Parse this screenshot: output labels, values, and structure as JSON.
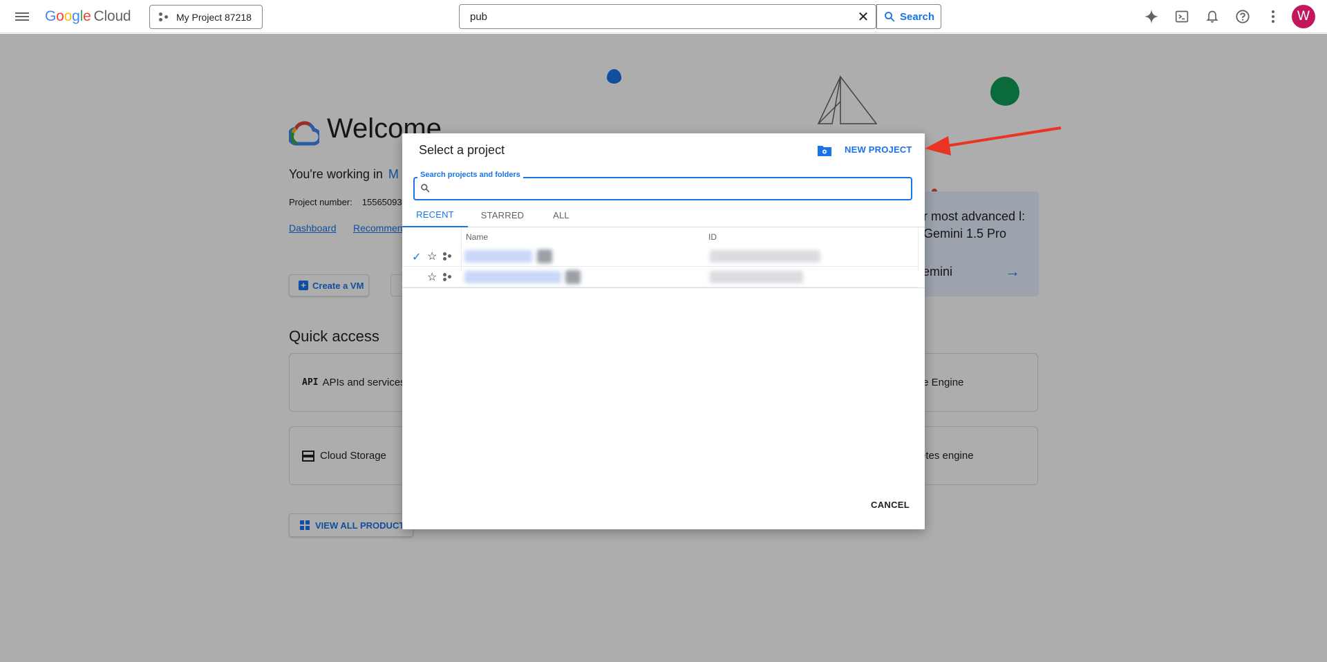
{
  "topbar": {
    "logo_google": [
      "G",
      "o",
      "o",
      "g",
      "l",
      "e"
    ],
    "logo_cloud": "Cloud",
    "project_picker_label": "My Project 87218",
    "search_value": "pub",
    "search_button": "Search",
    "avatar_letter": "W"
  },
  "background": {
    "welcome_title": "Welcome",
    "working_in_prefix": "You're working in",
    "working_in_project": "M",
    "project_number_label": "Project number:",
    "project_number_value": "15565093",
    "links": [
      "Dashboard",
      "Recommen"
    ],
    "create_vm_label": "Create a VM",
    "quick_access_title": "Quick access",
    "quick_cards": [
      {
        "icon": "API",
        "label": "APIs and services"
      },
      {
        "icon": "storage-icon",
        "label": "Cloud Storage"
      }
    ],
    "right_cards": [
      "te Engine",
      "etes engine"
    ],
    "view_all_label": "VIEW ALL PRODUCTS",
    "gemini_text": "r most advanced l: Gemini 1.5 Pro",
    "gemini_try": "emini"
  },
  "dialog": {
    "title": "Select a project",
    "new_project_label": "NEW PROJECT",
    "search_label": "Search projects and folders",
    "search_value": "",
    "tabs": [
      "RECENT",
      "STARRED",
      "ALL"
    ],
    "active_tab": "RECENT",
    "columns": {
      "name": "Name",
      "id": "ID"
    },
    "cancel_label": "CANCEL"
  },
  "colors": {
    "accent": "#1a73e8",
    "annotation_arrow": "#ea3323",
    "avatar_bg": "#c2185b"
  }
}
